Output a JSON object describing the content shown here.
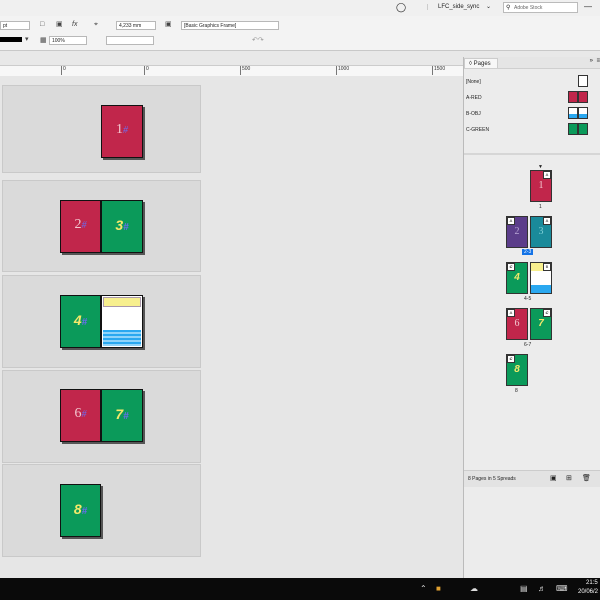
{
  "topbar": {
    "doc_name": "LFC_side_sync",
    "search_placeholder": "Adobe Stock"
  },
  "control": {
    "stroke_unit": "pt",
    "zoom": "100%",
    "measure": "4,233 mm",
    "frame_style": "[Basic Graphics Frame]"
  },
  "ruler": {
    "ticks": [
      "0",
      "0",
      "500",
      "1000",
      "1500"
    ]
  },
  "canvas": {
    "pages": [
      {
        "num": "1",
        "style": "serif"
      },
      {
        "num": "2",
        "style": "serif"
      },
      {
        "num": "3",
        "style": "hollow"
      },
      {
        "num": "4",
        "style": "hollow"
      },
      {
        "num": "6",
        "style": "serif"
      },
      {
        "num": "7",
        "style": "hollow"
      },
      {
        "num": "8",
        "style": "hollow"
      }
    ],
    "hash": "#"
  },
  "panel": {
    "title": "Pages",
    "masters": [
      {
        "label": "[None]"
      },
      {
        "label": "A-RED"
      },
      {
        "label": "B-OBJ"
      },
      {
        "label": "C-GREEN"
      }
    ],
    "spread_labels": [
      "1",
      "2-3",
      "4-5",
      "6-7",
      "8"
    ],
    "thumbs": [
      {
        "num": "1",
        "tag": "A"
      },
      {
        "num": "2",
        "tag": "A"
      },
      {
        "num": "3",
        "tag": "A"
      },
      {
        "num": "4",
        "tag": "C"
      },
      {
        "num": "",
        "tag": "B"
      },
      {
        "num": "6",
        "tag": "A"
      },
      {
        "num": "7",
        "tag": "C"
      },
      {
        "num": "8",
        "tag": "C"
      }
    ],
    "footer": "8 Pages in 5 Spreads"
  },
  "taskbar": {
    "time": "21:5",
    "date": "20/06/2"
  },
  "colors": {
    "red": "#c1264b",
    "green": "#0b9a5a",
    "purple": "#5b3d8a",
    "teal": "#1a8a9a",
    "selected_blue": "#1473e6"
  }
}
